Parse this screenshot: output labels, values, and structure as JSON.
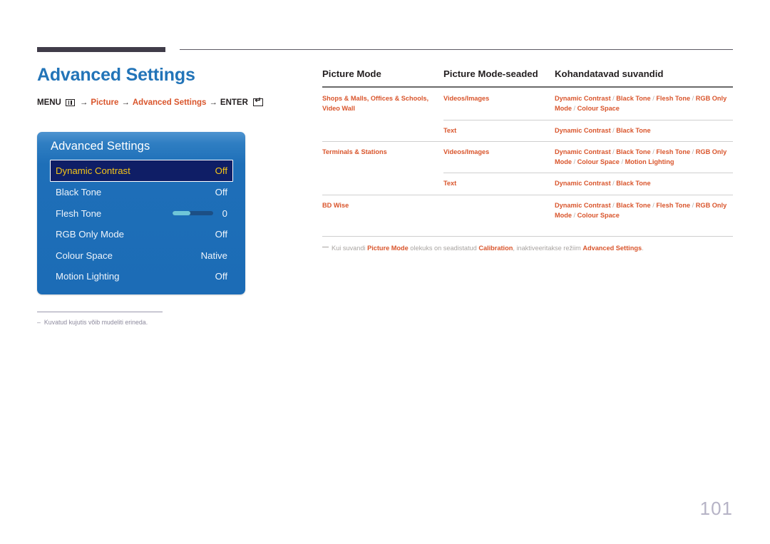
{
  "page": {
    "title": "Advanced Settings",
    "number": "101"
  },
  "breadcrumb": {
    "menu_label": "MENU",
    "menu_icon": "menu-grid-icon",
    "arrow": "→",
    "step1": "Picture",
    "step2": "Advanced Settings",
    "enter_label": "ENTER",
    "enter_icon": "enter-key-icon"
  },
  "osd": {
    "title": "Advanced Settings",
    "rows": [
      {
        "label": "Dynamic Contrast",
        "value": "Off",
        "selected": true,
        "type": "value"
      },
      {
        "label": "Black Tone",
        "value": "Off",
        "selected": false,
        "type": "value"
      },
      {
        "label": "Flesh Tone",
        "value": "0",
        "selected": false,
        "type": "slider",
        "slider_percent": 45
      },
      {
        "label": "RGB Only Mode",
        "value": "Off",
        "selected": false,
        "type": "value"
      },
      {
        "label": "Colour Space",
        "value": "Native",
        "selected": false,
        "type": "value"
      },
      {
        "label": "Motion Lighting",
        "value": "Off",
        "selected": false,
        "type": "value"
      }
    ],
    "colors": {
      "panel_top": "#4f94d0",
      "panel_body": "#1c6cb6",
      "selected_bg": "#0f1e66",
      "selected_text": "#f5c518",
      "slider_fill": "#6fc6d8",
      "slider_track": "#1c4f85"
    }
  },
  "left_note": {
    "dash": "–",
    "text": "Kuvatud kujutis võib mudeliti erineda."
  },
  "table": {
    "headers": [
      "Picture Mode",
      "Picture Mode-seaded",
      "Kohandatavad suvandid"
    ],
    "rows": [
      {
        "mode": "Shops & Malls, Offices & Schools, Video Wall",
        "subrows": [
          {
            "source": "Videos/Images",
            "options": "Dynamic Contrast / Black Tone / Flesh Tone / RGB Only Mode / Colour Space"
          },
          {
            "source": "Text",
            "options": "Dynamic Contrast / Black Tone"
          }
        ]
      },
      {
        "mode": "Terminals & Stations",
        "subrows": [
          {
            "source": "Videos/Images",
            "options": "Dynamic Contrast / Black Tone / Flesh Tone / RGB Only Mode / Colour Space / Motion Lighting"
          },
          {
            "source": "Text",
            "options": "Dynamic Contrast / Black Tone"
          }
        ]
      },
      {
        "mode": "BD Wise",
        "subrows": [
          {
            "source": "",
            "options": "Dynamic Contrast / Black Tone / Flesh Tone / RGB Only Mode / Colour Space"
          }
        ]
      }
    ]
  },
  "right_note": {
    "prefix": "Kui suvandi ",
    "b1": "Picture Mode",
    "mid1": " olekuks on seadistatud ",
    "b2": "Calibration",
    "mid2": ", inaktiveeritakse režiim ",
    "b3": "Advanced Settings",
    "suffix": "."
  },
  "colors": {
    "accent_blue": "#2274b8",
    "accent_orange": "#d9552c",
    "rule_dark": "#403c49"
  }
}
